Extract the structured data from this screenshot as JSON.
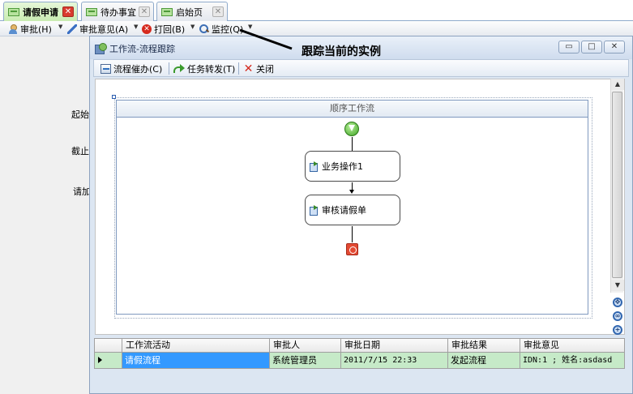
{
  "tabs": [
    {
      "label": "请假申请",
      "active": true
    },
    {
      "label": "待办事宜",
      "active": false
    },
    {
      "label": "启始页",
      "active": false
    }
  ],
  "toolbar": {
    "approve": "审批(H)",
    "opinion": "审批意见(A)",
    "reject": "打回(B)",
    "monitor": "监控(Q)"
  },
  "background_labels": {
    "a": "起始",
    "b": "截止",
    "c": "请加"
  },
  "annotation": "跟踪当前的实例",
  "window": {
    "title": "工作流-流程跟踪",
    "minimize": "▭",
    "maximize": "□",
    "close": "✕"
  },
  "window_toolbar": {
    "urge": "流程催办(C)",
    "forward": "任务转发(T)",
    "close": "关闭"
  },
  "workflow": {
    "title": "顺序工作流",
    "activities": [
      "业务操作1",
      "审核请假单"
    ],
    "start_icon": "start-arrow-icon",
    "end_icon": "stop-icon"
  },
  "grid": {
    "columns": [
      "工作流活动",
      "审批人",
      "审批日期",
      "审批结果",
      "审批意见"
    ],
    "rows": [
      {
        "activity": "请假流程",
        "approver": "系统管理员",
        "date": "2011/7/15 22:33",
        "result": "发起流程",
        "opinion": "IDN:1  ;  姓名:asdasd"
      }
    ]
  },
  "colors": {
    "active_tab": "#c8ebb0",
    "grid_row": "#c6eac8",
    "selected_cell": "#3399ff",
    "close_red": "#d93b2f"
  }
}
